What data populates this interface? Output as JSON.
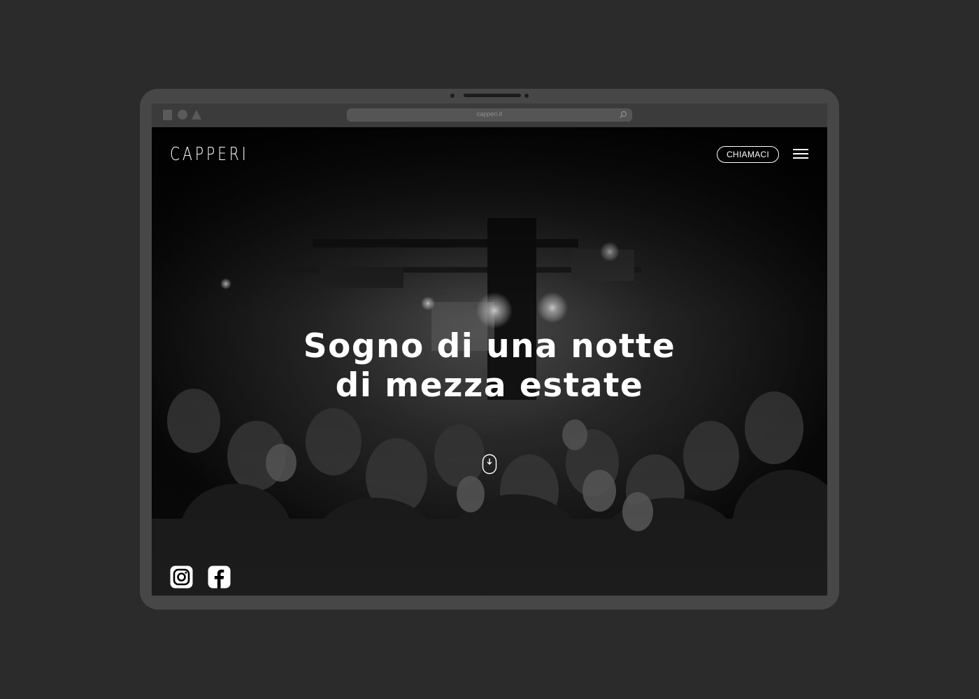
{
  "browser": {
    "url": "capperi.it",
    "search_icon": "search-icon"
  },
  "site": {
    "logo": "CAPPERI",
    "call_button_label": "CHIAMACI",
    "menu_icon": "hamburger-menu-icon",
    "headline_line1": "Sogno di una notte",
    "headline_line2": "di mezza estate",
    "scroll_icon": "mouse-scroll-icon",
    "social_icons": [
      "instagram-icon",
      "facebook-icon"
    ]
  },
  "colors": {
    "page_background": "#2b2b2b",
    "device_frame": "#474747",
    "text": "#ffffff"
  }
}
